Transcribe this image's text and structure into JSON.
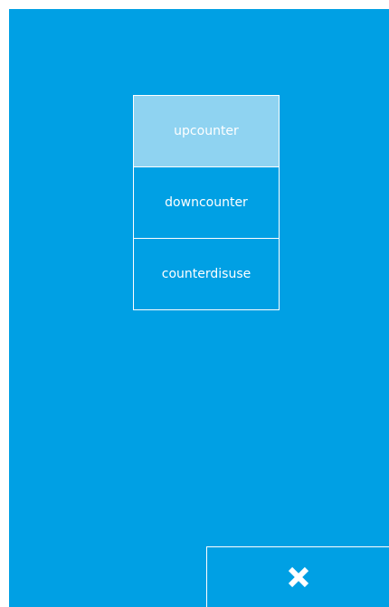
{
  "menu": {
    "options": [
      {
        "label": "upcounter",
        "selected": true
      },
      {
        "label": "downcounter",
        "selected": false
      },
      {
        "label": "counterdisuse",
        "selected": false
      }
    ]
  },
  "close_button": {
    "icon": "close-icon"
  },
  "colors": {
    "background": "#00a0e4",
    "selected": "#8fd3f1",
    "border": "#ffffff",
    "text": "#ffffff"
  }
}
